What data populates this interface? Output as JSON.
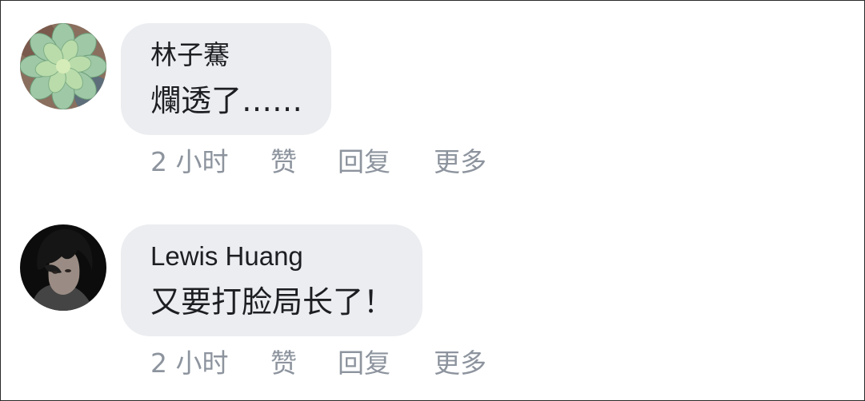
{
  "comments": [
    {
      "author": "林子騫",
      "text": "爛透了……",
      "actions": {
        "time": "2 小时",
        "like": "赞",
        "reply": "回复",
        "more": "更多"
      }
    },
    {
      "author": "Lewis Huang",
      "text": "又要打脸局长了！",
      "actions": {
        "time": "2 小时",
        "like": "赞",
        "reply": "回复",
        "more": "更多"
      }
    }
  ]
}
